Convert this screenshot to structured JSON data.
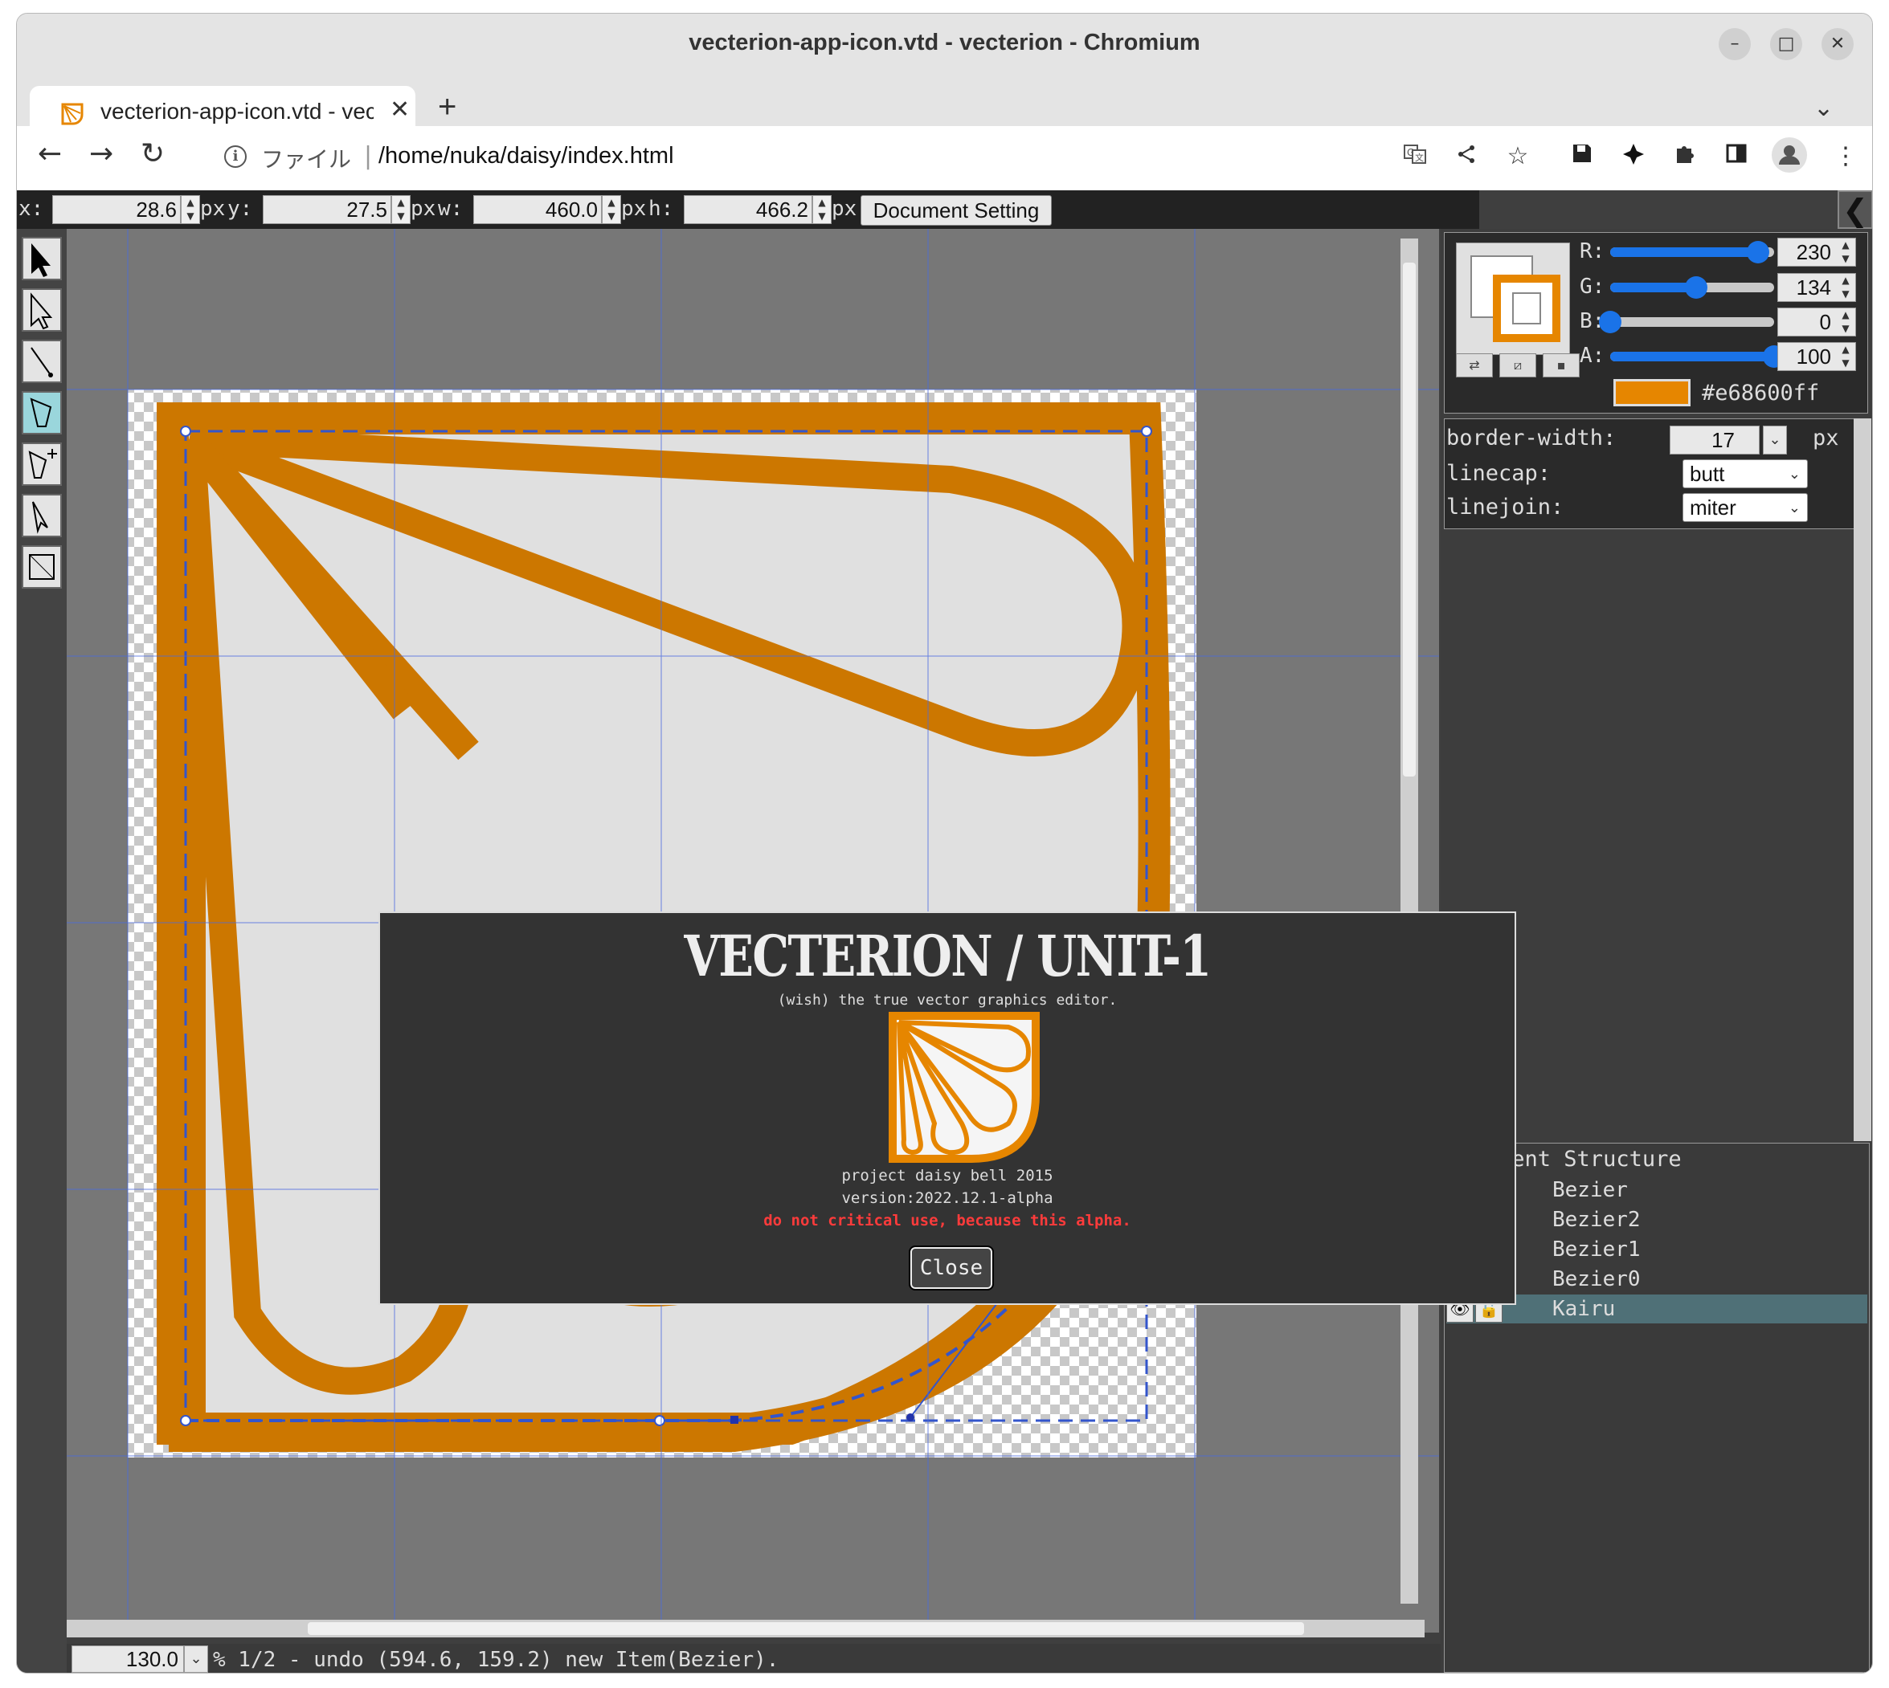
{
  "window": {
    "title": "vecterion-app-icon.vtd - vecterion - Chromium",
    "min_glyph": "–",
    "max_glyph": "□",
    "close_glyph": "✕"
  },
  "tab": {
    "title": "vecterion-app-icon.vtd - vecterion",
    "close_glyph": "✕",
    "new_tab_glyph": "+",
    "tab_search_glyph": "⌄"
  },
  "toolbar": {
    "back": "←",
    "forward": "→",
    "reload": "↻",
    "scheme_label": "ファイル",
    "separator": "|",
    "url": "/home/nuka/daisy/index.html",
    "icons": [
      "translate-icon",
      "share-icon",
      "bookmark-star-icon",
      "save-extension-icon",
      "extension-puzzle-icon",
      "extensions-icon",
      "side-panel-icon",
      "profile-icon",
      "menu-icon"
    ]
  },
  "props": {
    "x_label": "x:",
    "x_value": "28.6",
    "x_unit": "px",
    "y_label": "y:",
    "y_value": "27.5",
    "y_unit": "px",
    "w_label": "w:",
    "w_value": "460.0",
    "w_unit": "px",
    "h_label": "h:",
    "h_value": "466.2",
    "h_unit": "px",
    "doc_setting": "Document Setting",
    "collapse_glyph": "❮"
  },
  "color": {
    "r_label": "R:",
    "r": "230",
    "r_frac": 0.902,
    "g_label": "G:",
    "g": "134",
    "g_frac": 0.525,
    "b_label": "B:",
    "b": "0",
    "b_frac": 0.0,
    "a_label": "A:",
    "a": "100",
    "a_frac": 1.0,
    "hex": "#e68600ff",
    "accent": "#e68600",
    "slider_blue": "#1a73e8"
  },
  "stroke": {
    "border_width_label": "border-width:",
    "border_width": "17",
    "unit": "px",
    "linecap_label": "linecap:",
    "linecap": "butt",
    "linejoin_label": "linejoin:",
    "linejoin": "miter"
  },
  "docstruct": {
    "title": "Document Structure",
    "items": [
      {
        "name": "Bezier"
      },
      {
        "name": "Bezier2"
      },
      {
        "name": "Bezier1"
      },
      {
        "name": "Bezier0"
      },
      {
        "name": "Kairu"
      }
    ],
    "selected_index": 4
  },
  "status": {
    "zoom": "130.0",
    "text": "% 1/2 - undo (594.6, 159.2) new Item(Bezier)."
  },
  "modal": {
    "title": "VECTERION / UNIT-1",
    "subtitle": "(wish) the true vector graphics editor.",
    "line1": "project daisy bell 2015",
    "line2": "version:2022.12.1-alpha",
    "warning": "do not critical use, because this alpha.",
    "close": "Close"
  }
}
